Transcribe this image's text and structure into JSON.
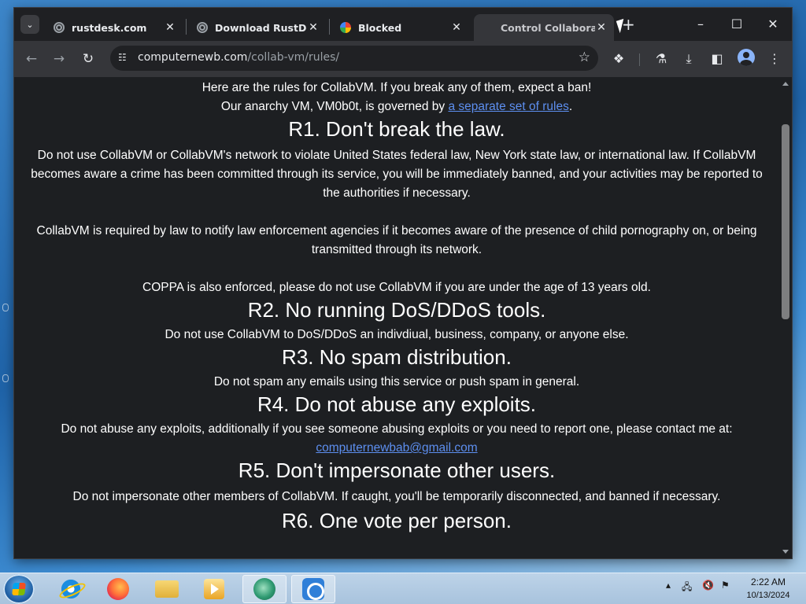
{
  "tabs": [
    {
      "title": "rustdesk.com",
      "favicon": "globe-icon",
      "active": false
    },
    {
      "title": "Download RustDesk",
      "favicon": "globe-icon",
      "active": false
    },
    {
      "title": "Blocked",
      "favicon": "google-icon",
      "active": false
    },
    {
      "title": "Control Collaborative",
      "favicon": "none",
      "active": true
    }
  ],
  "toolbar": {
    "url_host": "computernewb.com",
    "url_path": "/collab-vm/rules/"
  },
  "page": {
    "intro": "Here are the rules for CollabVM. If you break any of them, expect a ban!",
    "anarchy_prefix": "Our anarchy VM, VM0b0t, is governed by ",
    "anarchy_link": "a separate set of rules",
    "anarchy_suffix": ".",
    "rules": [
      {
        "heading": "R1. Don't break the law.",
        "paragraphs": [
          "Do not use CollabVM or CollabVM's network to violate United States federal law, New York state law, or international law. If CollabVM becomes aware a crime has been committed through its service, you will be immediately banned, and your activities may be reported to the authorities if necessary.",
          "CollabVM is required by law to notify law enforcement agencies if it becomes aware of the presence of child pornography on, or being transmitted through its network.",
          "COPPA is also enforced, please do not use CollabVM if you are under the age of 13 years old."
        ]
      },
      {
        "heading": "R2. No running DoS/DDoS tools.",
        "paragraphs": [
          "Do not use CollabVM to DoS/DDoS an indivdiual, business, company, or anyone else."
        ]
      },
      {
        "heading": "R3. No spam distribution.",
        "paragraphs": [
          "Do not spam any emails using this service or push spam in general."
        ]
      },
      {
        "heading": "R4. Do not abuse any exploits.",
        "paragraphs": [
          "Do not abuse any exploits, additionally if you see someone abusing exploits or you need to report one, please contact me at:"
        ],
        "email": "computernewbab@gmail.com"
      },
      {
        "heading": "R5. Don't impersonate other users.",
        "paragraphs": [
          "Do not impersonate other members of CollabVM. If caught, you'll be temporarily disconnected, and banned if necessary."
        ]
      },
      {
        "heading": "R6. One vote per person."
      }
    ]
  },
  "taskbar": {
    "apps": [
      "internet-explorer-icon",
      "firefox-icon",
      "file-explorer-icon",
      "media-player-icon",
      "rustdesk-green-icon",
      "rustdesk-icon"
    ],
    "time": "2:22 AM",
    "date": "10/13/2024"
  },
  "colors": {
    "page_bg": "#1d1f22",
    "link": "#5d8ff0",
    "tab_active": "#35363a"
  }
}
